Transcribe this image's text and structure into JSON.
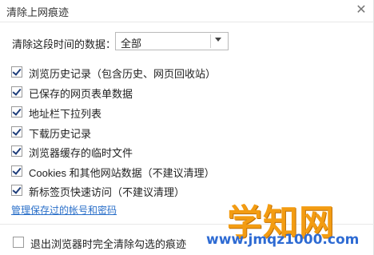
{
  "window": {
    "title": "清除上网痕迹"
  },
  "range": {
    "label": "清除这段时间的数据：",
    "selected": "全部"
  },
  "options": [
    {
      "label": "浏览历史记录（包含历史、网页回收站）",
      "checked": true
    },
    {
      "label": "已保存的网页表单数据",
      "checked": true
    },
    {
      "label": "地址栏下拉列表",
      "checked": true
    },
    {
      "label": "下载历史记录",
      "checked": true
    },
    {
      "label": "浏览器缓存的临时文件",
      "checked": true
    },
    {
      "label": "Cookies 和其他网站数据（不建议清理）",
      "checked": true
    },
    {
      "label": "新标签页快速访问（不建议清理）",
      "checked": true
    }
  ],
  "manage_link": "管理保存过的帐号和密码",
  "exit_option": {
    "label": "退出浏览器时完全清除勾选的痕迹",
    "checked": false
  },
  "watermark": {
    "text": "学知网",
    "url": "www.jmqz1000.com"
  }
}
